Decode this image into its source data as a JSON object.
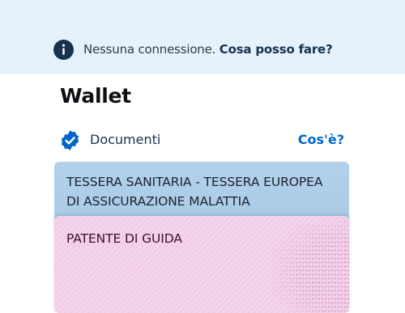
{
  "banner": {
    "message": "Nessuna connessione.",
    "link": "Cosa posso fare?"
  },
  "page": {
    "title": "Wallet"
  },
  "section": {
    "label": "Documenti",
    "info_link": "Cos'è?"
  },
  "cards": [
    {
      "title": "TESSERA SANITARIA - TESSERA EUROPEA DI ASSICURAZIONE MALATTIA"
    },
    {
      "title": "PATENTE DI GUIDA"
    }
  ],
  "colors": {
    "banner_bg": "#e6f2fb",
    "primary": "#0066cc",
    "dark": "#17324d",
    "health_card": "#b3d1ea",
    "license_card": "#f4d4ec"
  }
}
